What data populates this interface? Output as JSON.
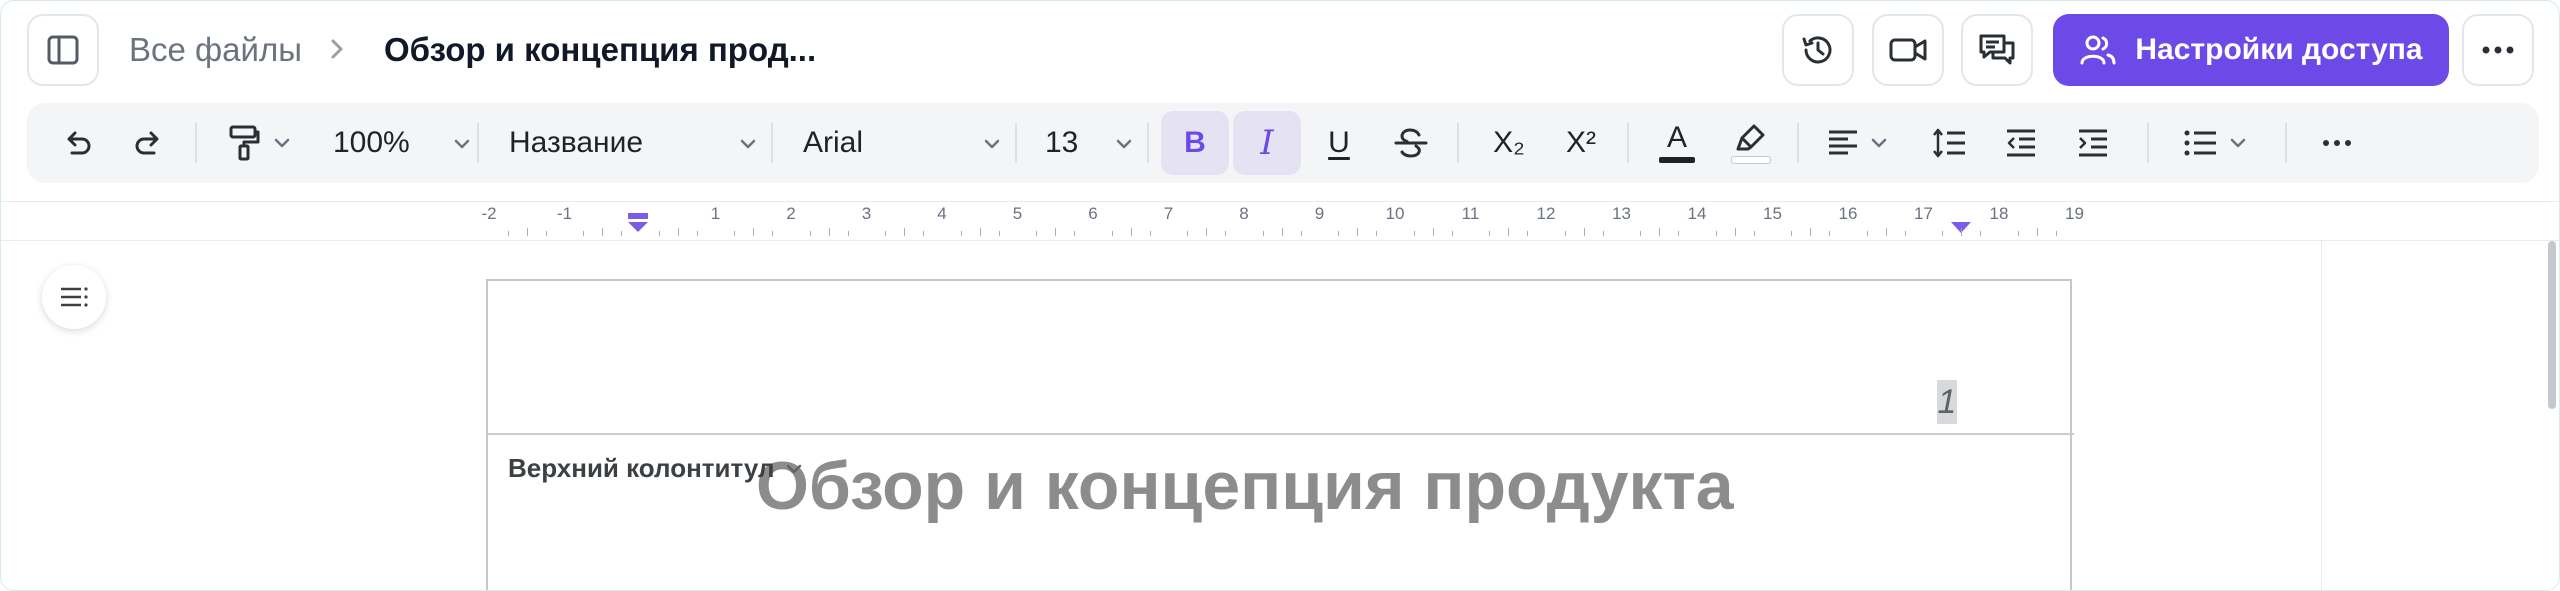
{
  "header": {
    "breadcrumb_root": "Все файлы",
    "document_title": "Обзор и концепция прод...",
    "share_label": "Настройки доступа",
    "accent_color": "#6d4ae8"
  },
  "toolbar": {
    "zoom": "100%",
    "paragraph_style": "Название",
    "font_name": "Arial",
    "font_size": "13",
    "bold": "B",
    "italic": "I",
    "underline": "U",
    "subscript": "X₂",
    "superscript": "X²",
    "text_color_letter": "A",
    "bold_active": true,
    "italic_active": true
  },
  "ruler": {
    "labels": [
      "-2",
      "-1",
      "",
      "1",
      "2",
      "3",
      "4",
      "5",
      "6",
      "7",
      "8",
      "9",
      "10",
      "11",
      "12",
      "13",
      "14",
      "15",
      "16",
      "17",
      "18",
      "19"
    ]
  },
  "page": {
    "page_number": "1",
    "header_label": "Верхний колонтитул",
    "title": "Обзор и концепция продукта"
  },
  "icons": [
    "sidebar-toggle-icon",
    "chevron-right-icon",
    "history-icon",
    "video-icon",
    "comments-icon",
    "users-icon",
    "more-horizontal-icon",
    "undo-icon",
    "redo-icon",
    "format-painter-icon",
    "chevron-down-icon",
    "strikethrough-icon",
    "text-color-icon",
    "highlighter-icon",
    "align-left-icon",
    "line-spacing-icon",
    "outdent-icon",
    "indent-icon",
    "list-icon",
    "outline-icon"
  ]
}
